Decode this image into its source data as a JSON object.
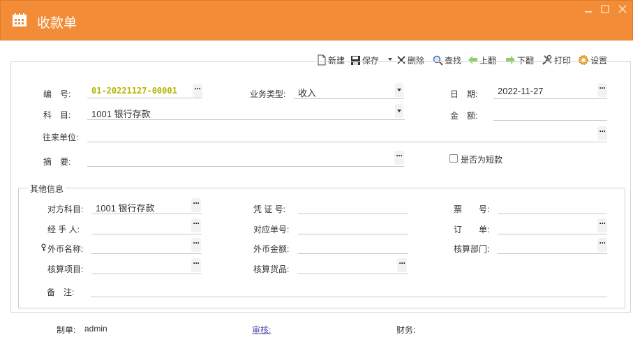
{
  "window": {
    "title": "收款单",
    "minimize_label": "minimize",
    "maximize_label": "maximize",
    "close_label": "close"
  },
  "toolbar": {
    "new_label": "新建",
    "save_label": "保存",
    "delete_label": "删除",
    "find_label": "查找",
    "prev_label": "上翻",
    "next_label": "下翻",
    "print_label": "打印",
    "settings_label": "设置"
  },
  "form": {
    "number_label": "编　号:",
    "number_value": "01-20221127-00001",
    "biz_type_label": "业务类型:",
    "biz_type_value": "收入",
    "date_label": "日　期:",
    "date_value": "2022-11-27",
    "subject_label": "科　目:",
    "subject_value": "1001 银行存款",
    "amount_label": "金　额:",
    "amount_value": "",
    "partner_label": "往来单位:",
    "partner_value": "",
    "summary_label": "摘　要:",
    "summary_value": "",
    "short_label": "是否为短款"
  },
  "other": {
    "title": "其他信息",
    "counter_subject_label": "对方科目:",
    "counter_subject_value": "1001 银行存款",
    "voucher_label": "凭 证 号:",
    "ticket_label": "票　　号:",
    "handler_label": "经 手 人:",
    "related_label": "对应单号:",
    "order_label": "订　　单:",
    "currency_label": "外币名称:",
    "currency_amount_label": "外币金额:",
    "dept_label": "核算部门:",
    "project_label": "核算项目:",
    "goods_label": "核算货品:",
    "remark_label": "备　注:"
  },
  "footer": {
    "maker_label": "制单:",
    "maker_value": "admin",
    "audit_label": "审核:",
    "finance_label": "财务:"
  },
  "colors": {
    "titlebar": "#f28c36",
    "number_value": "#b5b500",
    "audit_link": "#4a4aa8"
  }
}
